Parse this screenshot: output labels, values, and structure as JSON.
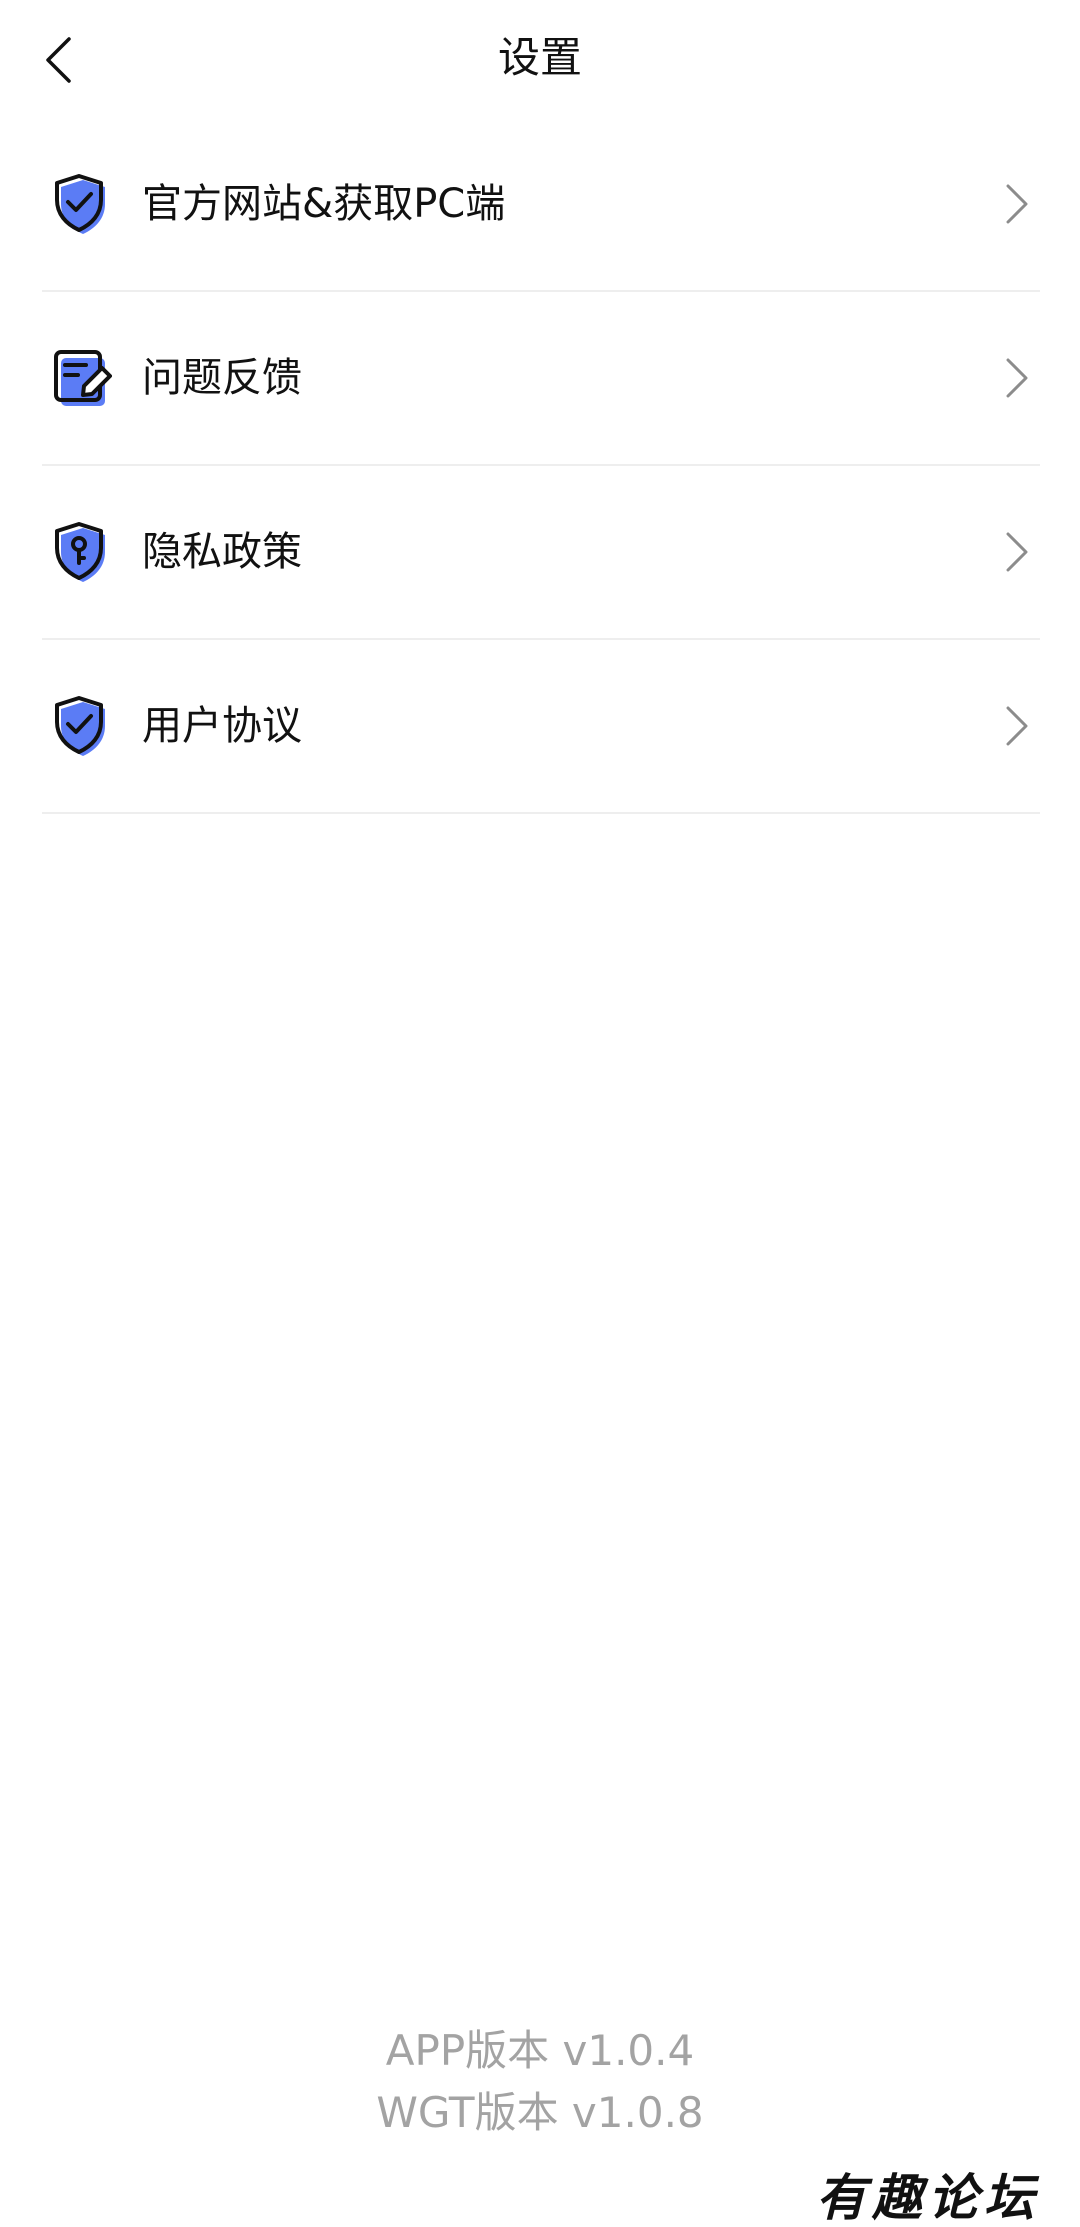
{
  "header": {
    "title": "设置",
    "back_icon": "chevron-left-icon"
  },
  "menu": {
    "items": [
      {
        "label": "官方网站&获取PC端",
        "icon": "shield-check-icon"
      },
      {
        "label": "问题反馈",
        "icon": "edit-note-icon"
      },
      {
        "label": "隐私政策",
        "icon": "shield-key-icon"
      },
      {
        "label": "用户协议",
        "icon": "shield-check-icon"
      }
    ],
    "arrow_icon": "chevron-right-icon"
  },
  "footer": {
    "app_version": "APP版本 v1.0.4",
    "wgt_version": "WGT版本 v1.0.8"
  },
  "watermark": "有趣论坛",
  "colors": {
    "accent": "#5b7cf5",
    "text": "#111111",
    "muted": "#a3a3a3",
    "divider": "#eeeeee"
  }
}
